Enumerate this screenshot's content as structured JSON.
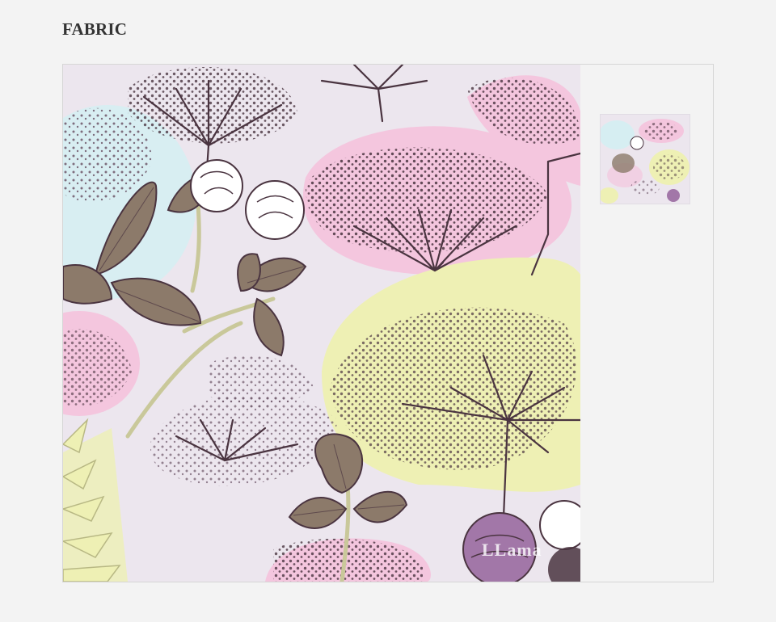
{
  "page": {
    "title": "FABRIC"
  },
  "gallery": {
    "main_image_watermark": "LLama",
    "thumbnail_count": 1,
    "colors": {
      "background": "#f3f3f3",
      "fabric_base": "#ece6ee",
      "pink": "#f4c6de",
      "yellow": "#eef0b4",
      "aqua": "#d6eef2",
      "ink": "#4a3440",
      "leaf": "#8c7a6a",
      "clover_purple": "#a277a8"
    }
  }
}
